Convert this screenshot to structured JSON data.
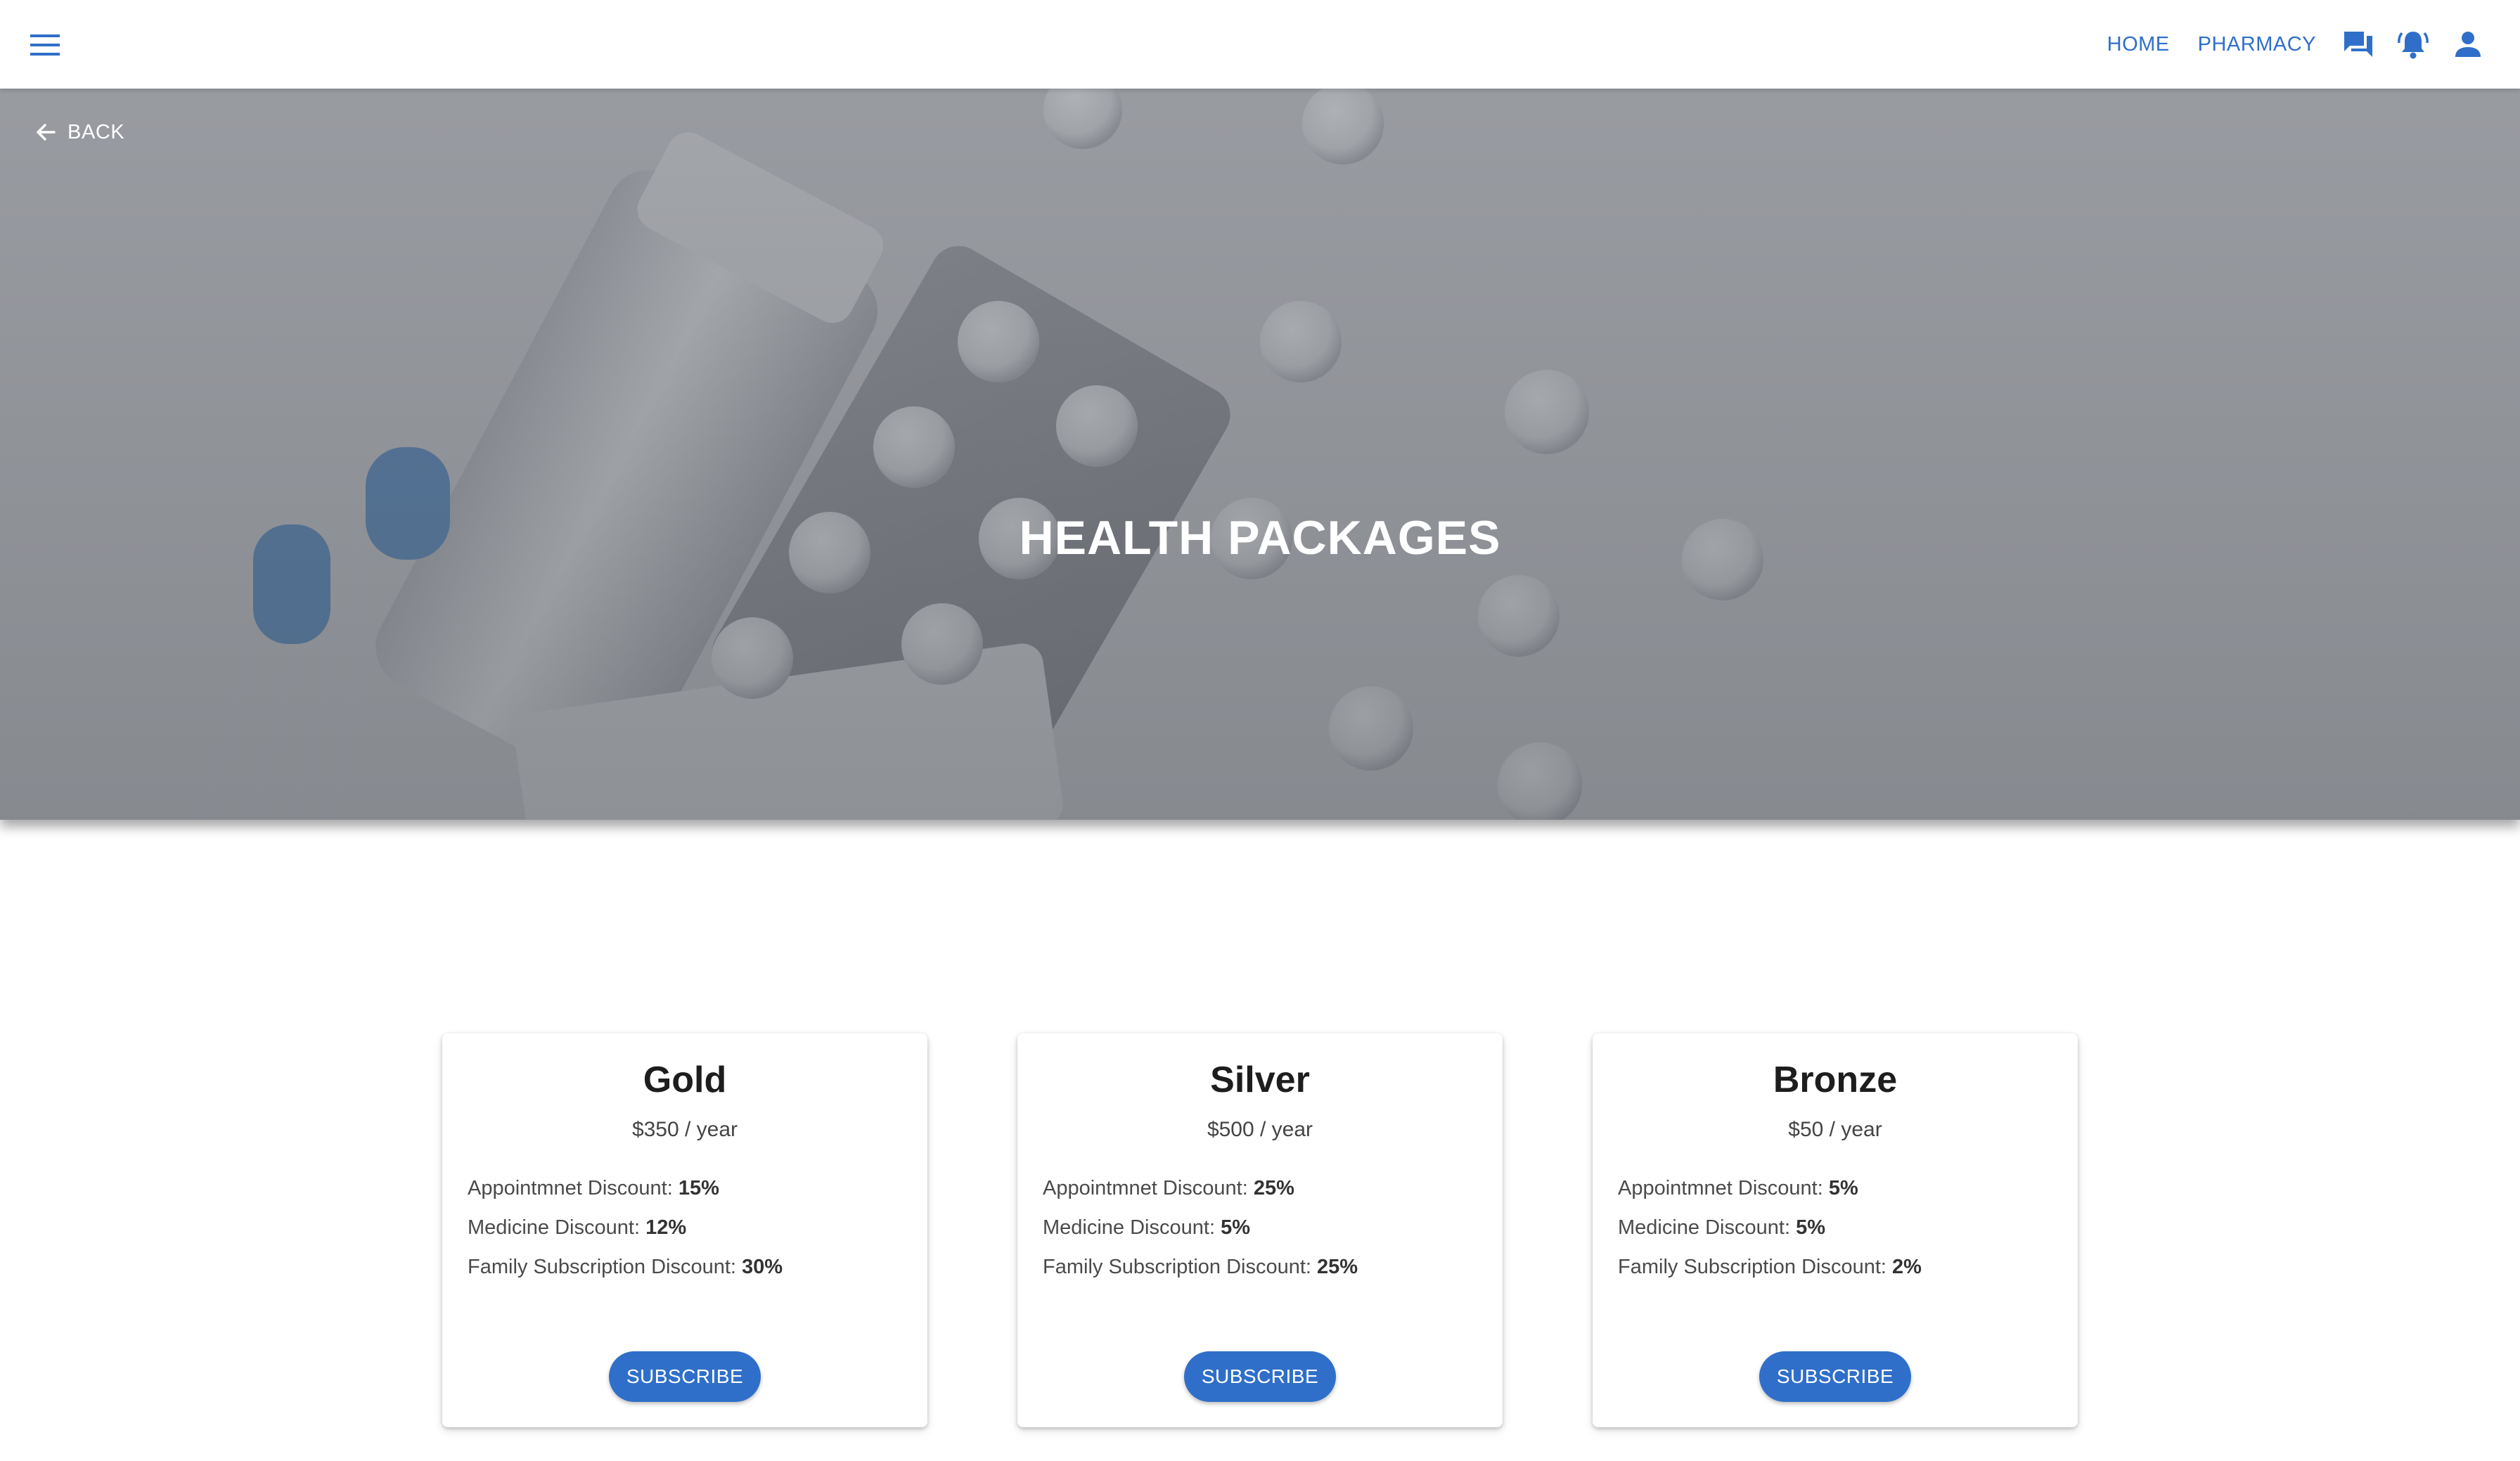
{
  "colors": {
    "primary": "#2f6fc9",
    "hero_overlay": "#7a7e85",
    "text": "#222222"
  },
  "appbar": {
    "menu_icon": "hamburger-menu-icon",
    "nav": {
      "home_label": "HOME",
      "pharmacy_label": "PHARMACY"
    },
    "icons": [
      "chat-icon",
      "notification-bell-icon",
      "account-icon"
    ]
  },
  "hero": {
    "back_label": "BACK",
    "title": "HEALTH PACKAGES"
  },
  "packages": [
    {
      "name": "Gold",
      "price": "$350 / year",
      "features": [
        {
          "label": "Appointmnet Discount: ",
          "value": "15%"
        },
        {
          "label": "Medicine Discount: ",
          "value": "12%"
        },
        {
          "label": "Family Subscription Discount: ",
          "value": "30%"
        }
      ],
      "button_label": "SUBSCRIBE"
    },
    {
      "name": "Silver",
      "price": "$500 / year",
      "features": [
        {
          "label": "Appointmnet Discount: ",
          "value": "25%"
        },
        {
          "label": "Medicine Discount: ",
          "value": "5%"
        },
        {
          "label": "Family Subscription Discount: ",
          "value": "25%"
        }
      ],
      "button_label": "SUBSCRIBE"
    },
    {
      "name": "Bronze",
      "price": "$50 / year",
      "features": [
        {
          "label": "Appointmnet Discount: ",
          "value": "5%"
        },
        {
          "label": "Medicine Discount: ",
          "value": "5%"
        },
        {
          "label": "Family Subscription Discount: ",
          "value": "2%"
        }
      ],
      "button_label": "SUBSCRIBE"
    }
  ]
}
